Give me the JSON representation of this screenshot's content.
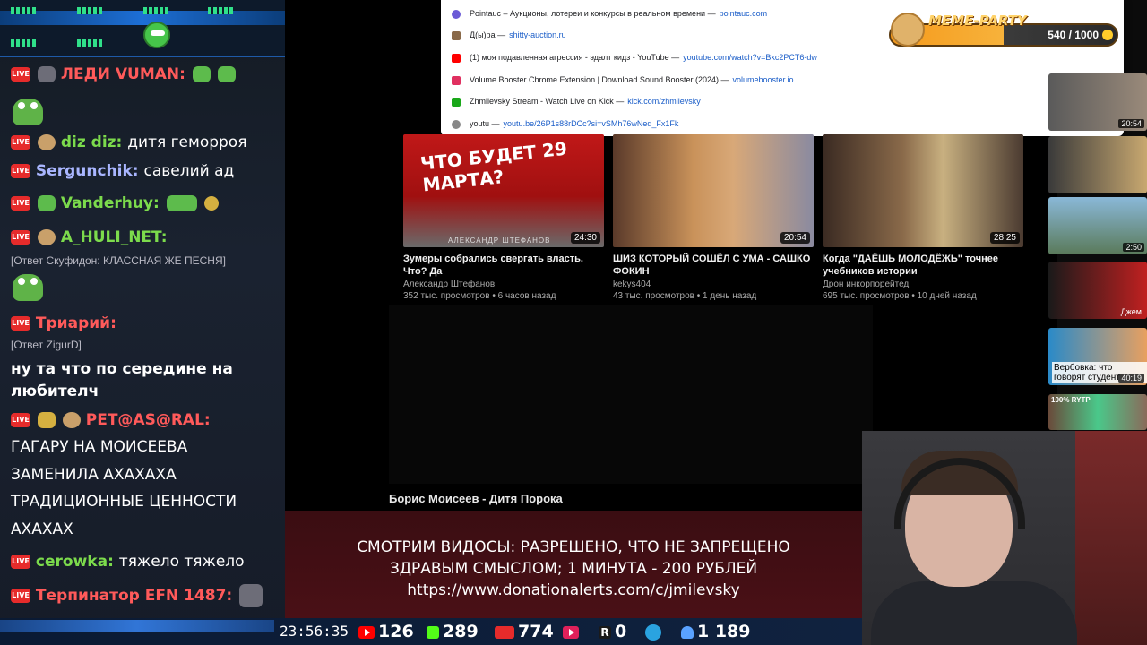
{
  "chat": {
    "messages": [
      {
        "nick": "ЛЕДИ VUMAN:",
        "nick_color": "#ff5a5a",
        "text": ""
      },
      {
        "nick": "diz diz:",
        "nick_color": "#7cdb4c",
        "text": "дитя геморроя"
      },
      {
        "nick": "Sergunchik:",
        "nick_color": "#a9b6ff",
        "text": "савелий ад"
      },
      {
        "nick": "Vanderhuy:",
        "nick_color": "#7cdb4c",
        "text": ""
      },
      {
        "nick": "A_HULI_NET:",
        "nick_color": "#7cdb4c",
        "text": ""
      },
      {
        "nick": "Триарий:",
        "nick_color": "#ff5a5a",
        "text": ""
      },
      {
        "nick": "PET@AS@RAL:",
        "nick_color": "#ff5a5a",
        "text": ""
      },
      {
        "nick": "cerowka:",
        "nick_color": "#7cdb4c",
        "text": "тяжело тяжело"
      },
      {
        "nick": "Терпинатор EFN 1487:",
        "nick_color": "#ff5a5a",
        "text": ""
      }
    ],
    "reply_1": "[Ответ Скуфидон: КЛАССНАЯ ЖЕ ПЕСНЯ]",
    "reply_2": "[Ответ ZigurD]",
    "triary_text": "ну та что по середине на любителч",
    "pet_text": "ГАГАРУ НА МОИСЕЕВА ЗАМЕНИЛА АХАХАХА ТРАДИЦИОННЫЕ ЦЕННОСТИ АХАХАХ",
    "live_label": "LIVE"
  },
  "dropdown": {
    "items": [
      {
        "title": "Pointauc – Аукционы, лотереи и конкурсы в реальном времени",
        "url": "pointauc.com",
        "icon": "pointauc-icon",
        "color": "#6b5bd6"
      },
      {
        "title": "Д(ы)ра",
        "url": "shitty-auction.ru",
        "icon": "page-icon",
        "color": "#8a6a4a"
      },
      {
        "title": "(1) моя подавленная агрессия - эдалт кидз - YouTube",
        "url": "youtube.com/watch?v=Bkc2PCT6-dw",
        "icon": "youtube-icon",
        "color": "#ff0000"
      },
      {
        "title": "Volume Booster Chrome Extension | Download Sound Booster (2024)",
        "url": "volumebooster.io",
        "icon": "volume-icon",
        "color": "#e03060"
      },
      {
        "title": "Zhmilevsky Stream - Watch Live on Kick",
        "url": "kick.com/zhmilevsky",
        "icon": "kick-icon",
        "color": "#1aa81a"
      },
      {
        "title": "youtu",
        "url": "youtu.be/26P1s88rDCc?si=vSMh76wNed_Fx1Fk",
        "icon": "globe-icon",
        "color": "#888888"
      }
    ]
  },
  "videos": [
    {
      "title": "Зумеры собрались свергать власть. Что? Да",
      "channel": "Александр Штефанов",
      "meta": "352 тыс. просмотров • 6 часов назад",
      "duration": "24:30",
      "thumb_text": "ЧТО БУДЕТ 29 МАРТА?",
      "thumb_caption": "АЛЕКСАНДР ШТЕФАНОВ"
    },
    {
      "title": "ШИЗ КОТОРЫЙ СОШЁЛ С УМА - САШКО ФОКИН",
      "channel": "kekys404",
      "meta": "43 тыс. просмотров • 1 день назад",
      "duration": "20:54"
    },
    {
      "title": "Когда \"ДАЁШЬ МОЛОДЁЖЬ\" точнее учебников истории",
      "channel": "Дрон инкорпорейтед",
      "meta": "695 тыс. просмотров • 10 дней назад",
      "duration": "28:25"
    }
  ],
  "sidebar_thumbs": [
    {
      "duration": "20:54",
      "text": ""
    },
    {
      "duration": "",
      "text": ""
    },
    {
      "duration": "2:50",
      "text": ""
    },
    {
      "duration": "",
      "text": "Джем"
    },
    {
      "duration": "40:19",
      "text": "Вербовка: что говорят студент"
    },
    {
      "duration": "",
      "text": "100% RYTP"
    }
  ],
  "now_playing": "Борис Моисеев - Дитя Порока",
  "meme_party": {
    "title": "MEME-PARTY",
    "count": "540 / 1000",
    "progress": 0.54
  },
  "donation": {
    "line1": "СМОТРИМ ВИДОСЫ: РАЗРЕШЕНО, ЧТО НЕ ЗАПРЕЩЕНО",
    "line2": "ЗДРАВЫМ СМЫСЛОМ; 1 МИНУТА - 200 РУБЛЕЙ",
    "line3": "https://www.donationalerts.com/c/jmilevsky"
  },
  "status_bar": {
    "time": "23:56:35",
    "youtube": "126",
    "kick": "289",
    "live": "774",
    "rutube": "0",
    "telegram": "",
    "viewers": "1 189",
    "rutube_glyph": "R"
  }
}
